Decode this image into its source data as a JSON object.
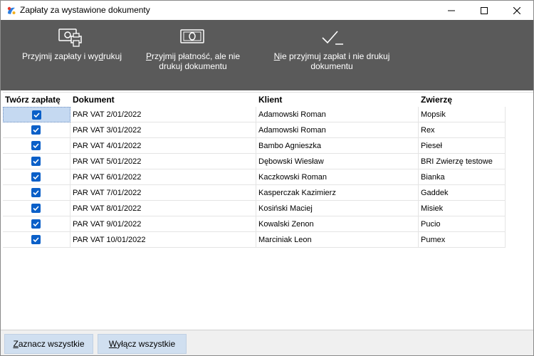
{
  "window": {
    "title": "Zapłaty za wystawione dokumenty",
    "icon": "app-logo-icon"
  },
  "toolbar": {
    "accept_print": {
      "icon": "money-printer-icon",
      "pre": "Przyjmij zapłaty i wy",
      "u": "d",
      "post": "rukuj"
    },
    "accept_no_print": {
      "icon": "banknote-icon",
      "l1_u": "P",
      "l1_rest": "rzyjmij płatność, ale nie",
      "l2": "drukuj dokumentu"
    },
    "no_accept": {
      "icon": "check-icon",
      "l1_u": "N",
      "l1_rest": "ie przyjmuj zapłat i nie drukuj",
      "l2": "dokumentu"
    }
  },
  "grid": {
    "headers": [
      "Twórz zapłatę",
      "Dokument",
      "Klient",
      "Zwierzę"
    ],
    "rows": [
      {
        "checked": true,
        "doc": "PAR VAT 2/01/2022",
        "client": "Adamowski Roman",
        "animal": "Mopsik"
      },
      {
        "checked": true,
        "doc": "PAR VAT 3/01/2022",
        "client": "Adamowski Roman",
        "animal": "Rex"
      },
      {
        "checked": true,
        "doc": "PAR VAT 4/01/2022",
        "client": "Bambo Agnieszka",
        "animal": "Pieseł"
      },
      {
        "checked": true,
        "doc": "PAR VAT 5/01/2022",
        "client": "Dębowski Wiesław",
        "animal": "BRI Zwierzę testowe"
      },
      {
        "checked": true,
        "doc": "PAR VAT 6/01/2022",
        "client": "Kaczkowski Roman",
        "animal": "Bianka"
      },
      {
        "checked": true,
        "doc": "PAR VAT 7/01/2022",
        "client": "Kasperczak Kazimierz",
        "animal": "Gaddek"
      },
      {
        "checked": true,
        "doc": "PAR VAT 8/01/2022",
        "client": "Kosiński Maciej",
        "animal": "Misiek"
      },
      {
        "checked": true,
        "doc": "PAR VAT 9/01/2022",
        "client": "Kowalski Zenon",
        "animal": "Pucio"
      },
      {
        "checked": true,
        "doc": "PAR VAT 10/01/2022",
        "client": "Marciniak Leon",
        "animal": "Pumex"
      }
    ]
  },
  "footer": {
    "select_all": {
      "u": "Z",
      "rest": "aznacz wszystkie"
    },
    "deselect_all": {
      "u": "W",
      "rest": "yłącz wszystkie"
    }
  },
  "colors": {
    "toolbar_bg": "#5a5a5a",
    "checkbox": "#0a5fc8",
    "button_bg": "#d0dff0",
    "selection": "#c5d9f1"
  }
}
